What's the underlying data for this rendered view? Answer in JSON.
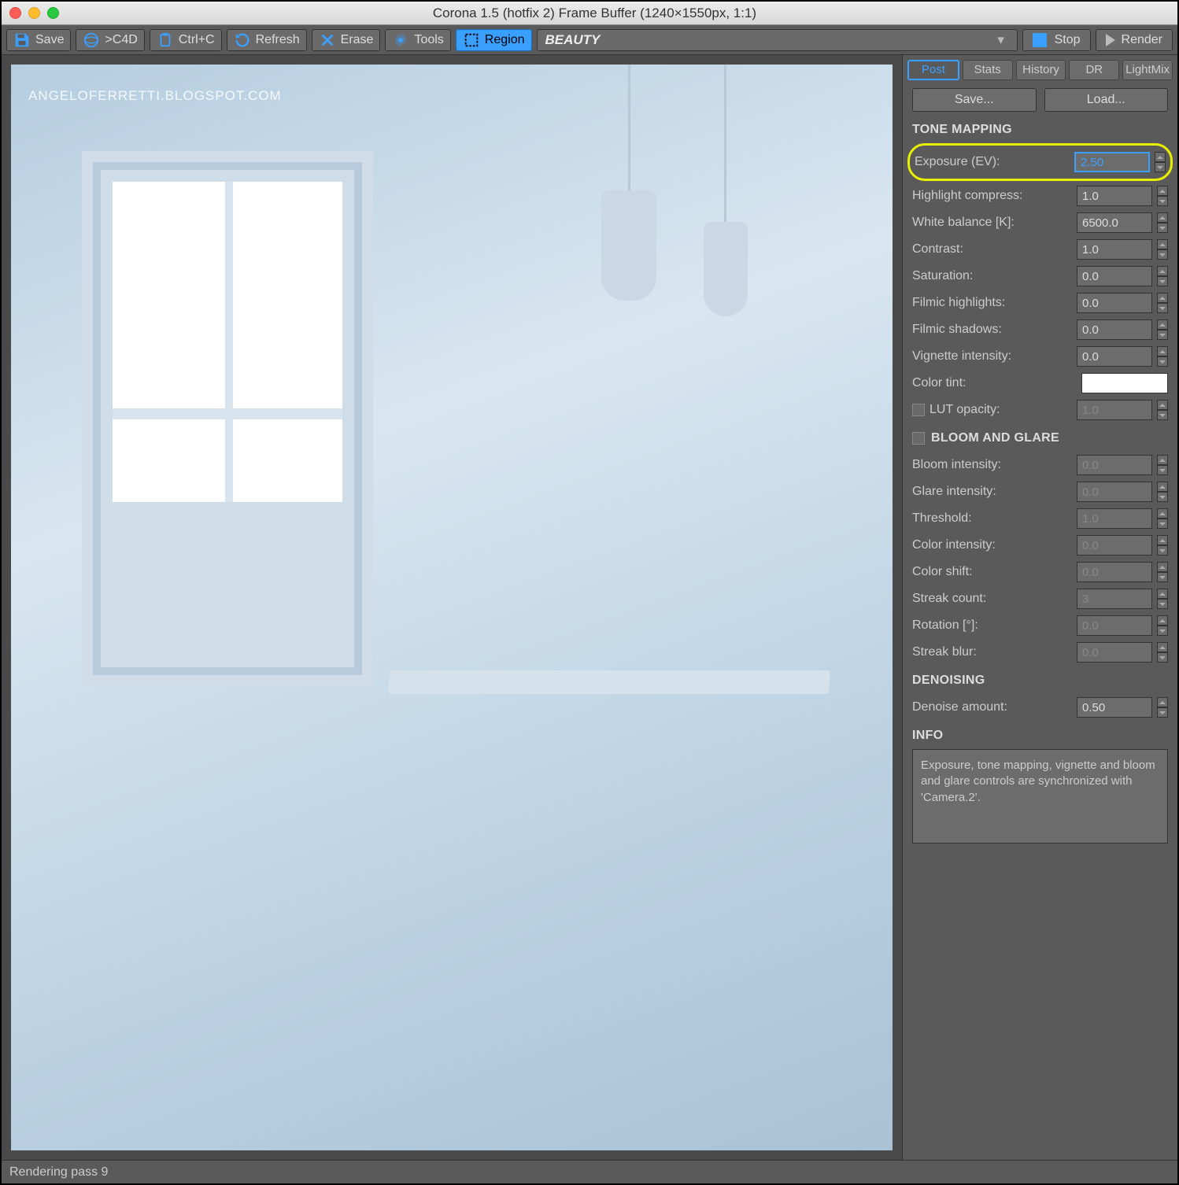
{
  "window": {
    "title": "Corona 1.5 (hotfix 2) Frame Buffer (1240×1550px, 1:1)"
  },
  "toolbar": {
    "save": "Save",
    "c4d": ">C4D",
    "copy": "Ctrl+C",
    "refresh": "Refresh",
    "erase": "Erase",
    "tools": "Tools",
    "region": "Region",
    "pass_select": "BEAUTY",
    "stop": "Stop",
    "render": "Render"
  },
  "viewport": {
    "watermark": "ANGELOFERRETTI.BLOGSPOT.COM"
  },
  "sidebar": {
    "tabs": [
      "Post",
      "Stats",
      "History",
      "DR",
      "LightMix"
    ],
    "active_tab": 0,
    "save_btn": "Save...",
    "load_btn": "Load...",
    "sections": {
      "tone_mapping": "TONE MAPPING",
      "bloom_glare": "BLOOM AND GLARE",
      "denoising": "DENOISING",
      "info": "INFO"
    },
    "tone_mapping": {
      "exposure": {
        "label": "Exposure (EV):",
        "value": "2.50"
      },
      "highlight": {
        "label": "Highlight compress:",
        "value": "1.0"
      },
      "white_balance": {
        "label": "White balance [K]:",
        "value": "6500.0"
      },
      "contrast": {
        "label": "Contrast:",
        "value": "1.0"
      },
      "saturation": {
        "label": "Saturation:",
        "value": "0.0"
      },
      "filmic_hi": {
        "label": "Filmic highlights:",
        "value": "0.0"
      },
      "filmic_sh": {
        "label": "Filmic shadows:",
        "value": "0.0"
      },
      "vignette": {
        "label": "Vignette intensity:",
        "value": "0.0"
      },
      "color_tint": {
        "label": "Color tint:",
        "value": "#ffffff"
      },
      "lut_opacity": {
        "label": "LUT opacity:",
        "value": "1.0"
      }
    },
    "bloom_glare": {
      "bloom_int": {
        "label": "Bloom intensity:",
        "value": "0.0"
      },
      "glare_int": {
        "label": "Glare intensity:",
        "value": "0.0"
      },
      "threshold": {
        "label": "Threshold:",
        "value": "1.0"
      },
      "color_int": {
        "label": "Color intensity:",
        "value": "0.0"
      },
      "color_shift": {
        "label": "Color shift:",
        "value": "0.0"
      },
      "streak_cnt": {
        "label": "Streak count:",
        "value": "3"
      },
      "rotation": {
        "label": "Rotation [°]:",
        "value": "0.0"
      },
      "streak_blur": {
        "label": "Streak blur:",
        "value": "0.0"
      }
    },
    "denoising": {
      "amount": {
        "label": "Denoise amount:",
        "value": "0.50"
      }
    },
    "info_text": "Exposure, tone mapping, vignette and bloom and glare controls are synchronized with 'Camera.2'."
  },
  "status": {
    "text": "Rendering pass 9"
  }
}
